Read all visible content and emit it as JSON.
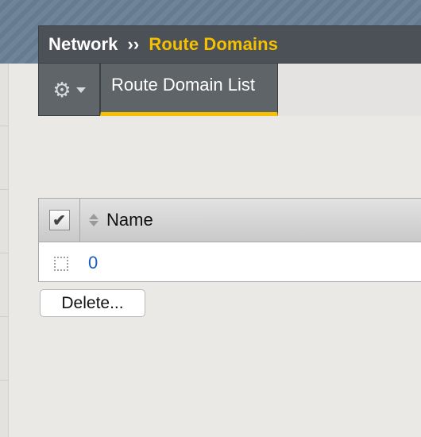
{
  "breadcrumb": {
    "section": "Network",
    "separator": "››",
    "current": "Route Domains"
  },
  "toolbar": {
    "menu_icon": "gear-icon",
    "tab_label": "Route Domain List"
  },
  "table": {
    "header_name": "Name",
    "select_all_checked": true,
    "rows": [
      {
        "name": "0",
        "checked": false
      }
    ]
  },
  "actions": {
    "delete_label": "Delete..."
  },
  "colors": {
    "accent": "#f5c000",
    "header_bg": "#4b5157",
    "link": "#1a5fb4"
  }
}
